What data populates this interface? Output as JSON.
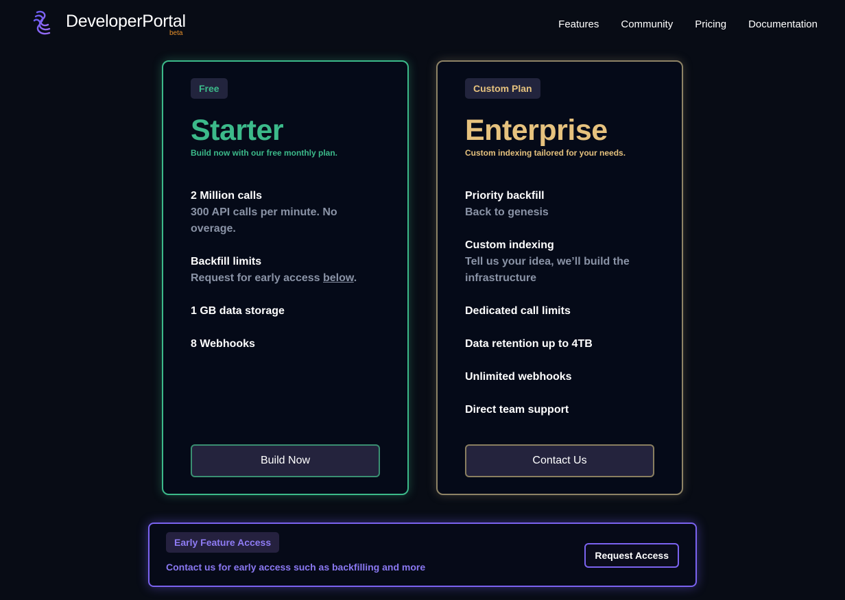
{
  "brand": {
    "name": "DeveloperPortal",
    "tag": "beta",
    "logo_icon": "spiral-logo-icon"
  },
  "nav": {
    "items": [
      "Features",
      "Community",
      "Pricing",
      "Documentation"
    ]
  },
  "plans": [
    {
      "badge": "Free",
      "name": "Starter",
      "description": "Build now with our free monthly plan.",
      "accent": "#3cba8a",
      "features": [
        {
          "title": "2 Million calls",
          "sub": "300 API calls per minute. No overage."
        },
        {
          "title": "Backfill limits",
          "sub_prefix": "Request for early access ",
          "sub_link": "below",
          "sub_suffix": "."
        },
        {
          "title": "1 GB data storage"
        },
        {
          "title": "8 Webhooks"
        }
      ],
      "cta": "Build Now"
    },
    {
      "badge": "Custom Plan",
      "name": "Enterprise",
      "description": "Custom indexing tailored for your needs.",
      "accent": "#e6c27e",
      "features": [
        {
          "title": "Priority backfill",
          "sub": "Back to genesis"
        },
        {
          "title": "Custom indexing",
          "sub": "Tell us your idea, we’ll build the infrastructure"
        },
        {
          "title": "Dedicated call limits"
        },
        {
          "title": "Data retention up to 4TB"
        },
        {
          "title": "Unlimited webhooks"
        },
        {
          "title": "Direct team support"
        }
      ],
      "cta": "Contact Us"
    }
  ],
  "early_access": {
    "badge": "Early Feature Access",
    "text": "Contact us for early access such as backfilling and more",
    "button": "Request Access",
    "accent": "#7b63f0"
  }
}
